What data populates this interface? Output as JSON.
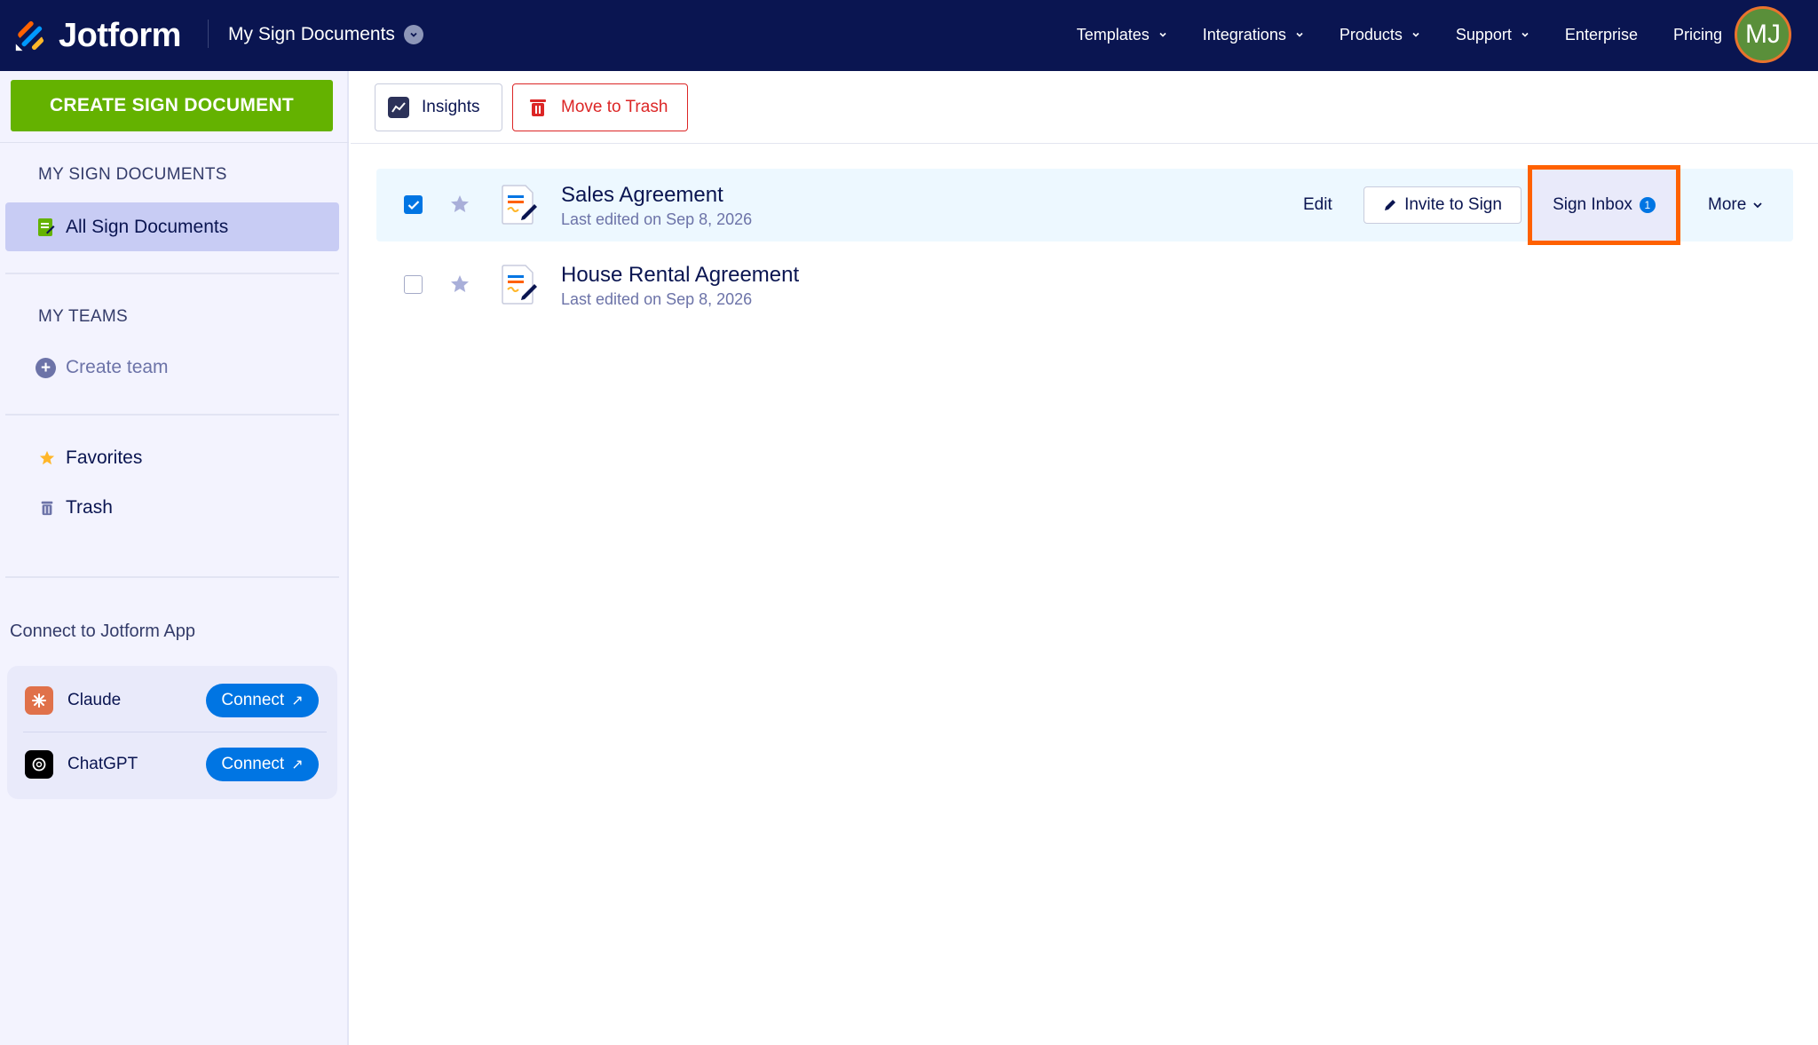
{
  "header": {
    "brand": "Jotform",
    "workspace": "My Sign Documents",
    "nav": [
      {
        "label": "Templates",
        "dropdown": true
      },
      {
        "label": "Integrations",
        "dropdown": true
      },
      {
        "label": "Products",
        "dropdown": true
      },
      {
        "label": "Support",
        "dropdown": true
      },
      {
        "label": "Enterprise",
        "dropdown": false
      },
      {
        "label": "Pricing",
        "dropdown": false
      }
    ],
    "avatar_initials": "MJ"
  },
  "sidebar": {
    "create_label": "CREATE SIGN DOCUMENT",
    "my_docs_title": "MY SIGN DOCUMENTS",
    "all_docs_label": "All Sign Documents",
    "my_teams_title": "MY TEAMS",
    "create_team_label": "Create team",
    "favorites_label": "Favorites",
    "trash_label": "Trash",
    "connect_title": "Connect to Jotform App",
    "apps": [
      {
        "name": "Claude",
        "button": "Connect"
      },
      {
        "name": "ChatGPT",
        "button": "Connect"
      }
    ]
  },
  "toolbar": {
    "insights_label": "Insights",
    "trash_label": "Move to Trash"
  },
  "documents": [
    {
      "title": "Sales Agreement",
      "subtitle": "Last edited on Sep 8, 2026",
      "selected": true
    },
    {
      "title": "House Rental Agreement",
      "subtitle": "Last edited on Sep 8, 2026",
      "selected": false
    }
  ],
  "row_actions": {
    "edit_label": "Edit",
    "invite_label": "Invite to Sign",
    "sign_inbox_label": "Sign Inbox",
    "sign_inbox_count": "1",
    "more_label": "More"
  },
  "colors": {
    "navy": "#0a1551",
    "green": "#64b200",
    "blue": "#0075e3",
    "highlight": "#ff6100",
    "danger": "#dc2626"
  }
}
